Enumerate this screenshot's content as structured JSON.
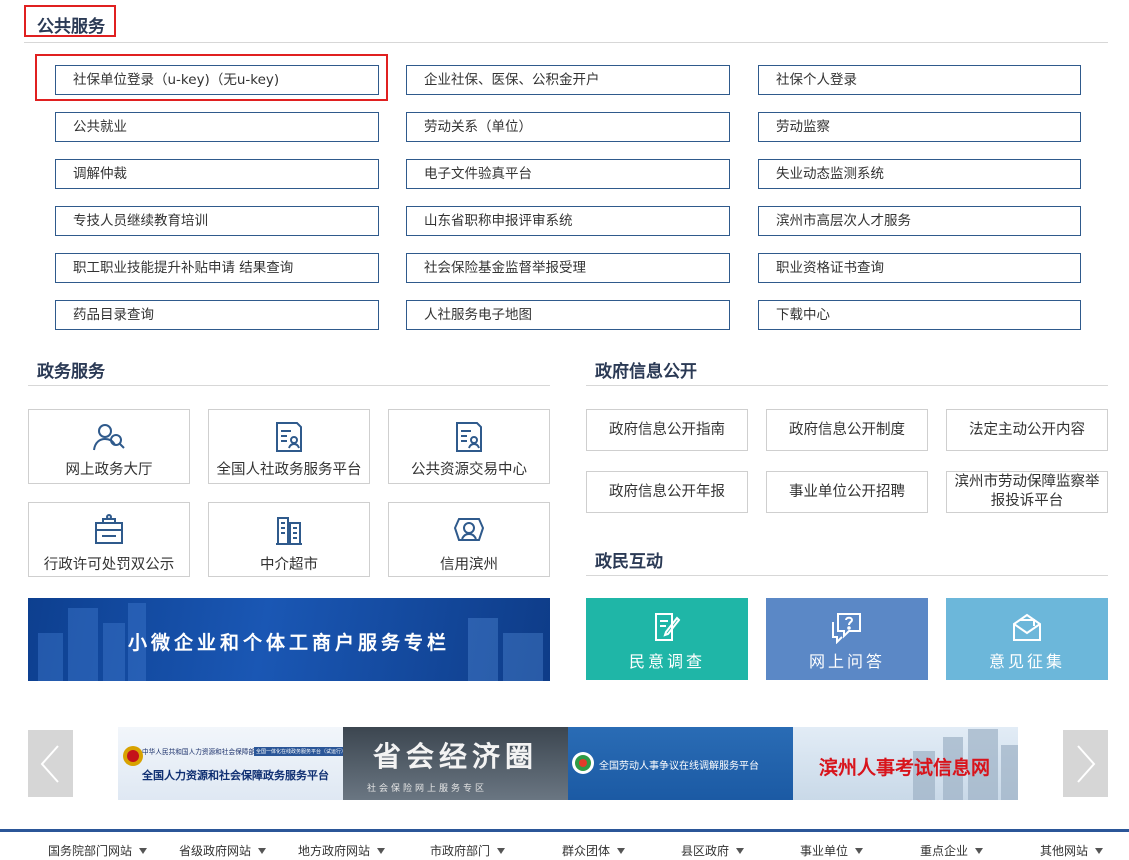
{
  "public_services": {
    "title": "公共服务",
    "items": [
      "社保单位登录（u-key)（无u-key)",
      "企业社保、医保、公积金开户",
      "社保个人登录",
      "公共就业",
      "劳动关系（单位）",
      "劳动监察",
      "调解仲裁",
      "电子文件验真平台",
      "失业动态监测系统",
      "专技人员继续教育培训",
      "山东省职称申报评审系统",
      "滨州市高层次人才服务",
      "职工职业技能提升补贴申请 结果查询",
      "社会保险基金监督举报受理",
      "职业资格证书查询",
      "药品目录查询",
      "人社服务电子地图",
      "下载中心"
    ]
  },
  "gov_services": {
    "title": "政务服务",
    "items": [
      {
        "label": "网上政务大厅",
        "icon": "people-icon"
      },
      {
        "label": "全国人社政务服务平台",
        "icon": "id-card-icon"
      },
      {
        "label": "公共资源交易中心",
        "icon": "id-card-icon"
      },
      {
        "label": "行政许可处罚双公示",
        "icon": "clipboard-icon"
      },
      {
        "label": "中介超市",
        "icon": "building-icon"
      },
      {
        "label": "信用滨州",
        "icon": "credit-icon"
      }
    ],
    "banner": "小微企业和个体工商户服务专栏"
  },
  "gov_info": {
    "title": "政府信息公开",
    "items": [
      "政府信息公开指南",
      "政府信息公开制度",
      "法定主动公开内容",
      "政府信息公开年报",
      "事业单位公开招聘",
      "滨州市劳动保障监察举报投诉平台"
    ]
  },
  "interaction": {
    "title": "政民互动",
    "tiles": [
      {
        "label": "民意调查",
        "color": "#1fb6a7",
        "icon": "edit-icon"
      },
      {
        "label": "网上问答",
        "color": "#5b88c6",
        "icon": "question-icon"
      },
      {
        "label": "意见征集",
        "color": "#6cb7da",
        "icon": "mail-icon"
      }
    ]
  },
  "carousel": {
    "ads": [
      {
        "small": "中华人民共和国人力资源和社会保障部",
        "tag": "全国一体化在线政务服务平台（试运行）",
        "main": "全国人力资源和社会保障政务服务平台"
      },
      {
        "main": "省会经济圈",
        "sub": "社会保险网上服务专区"
      },
      {
        "main": "全国劳动人事争议在线调解服务平台"
      },
      {
        "main": "滨州人事考试信息网"
      }
    ]
  },
  "footer_links": [
    "国务院部门网站",
    "省级政府网站",
    "地方政府网站",
    "市政府部门",
    "群众团体",
    "县区政府",
    "事业单位",
    "重点企业",
    "其他网站"
  ]
}
